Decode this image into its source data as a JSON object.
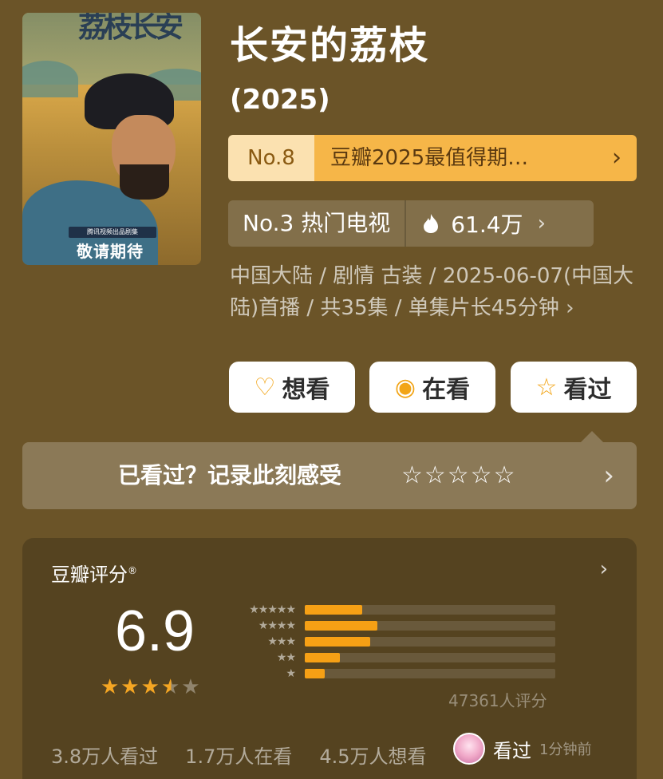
{
  "poster": {
    "title_art": "荔枝长安",
    "tag": "腾讯视频出品剧集",
    "banner": "敬请期待"
  },
  "title": "长安的荔枝",
  "year": "(2025)",
  "rank_primary": {
    "no": "No.8",
    "text": "豆瓣2025最值得期…",
    "chev": "›"
  },
  "rank_secondary": {
    "hot": "No.3 热门电视",
    "heat": "61.4万",
    "chev": "›"
  },
  "meta": "中国大陆 / 剧情 古装 / 2025-06-07(中国大陆)首播 / 共35集 / 单集片长45分钟 ›",
  "actions": {
    "want": {
      "icon": "♡",
      "label": "想看"
    },
    "watching": {
      "icon": "◉",
      "label": "在看"
    },
    "watched": {
      "icon": "☆",
      "label": "看过"
    }
  },
  "record": {
    "label": "已看过？记录此刻感受",
    "stars": "☆☆☆☆☆",
    "chev": "›"
  },
  "rating": {
    "label": "豆瓣评分",
    "reg": "®",
    "score": "6.9",
    "stars_value": 3.5,
    "stars_on": "★★★",
    "stars_half": "★",
    "stars_off": "★",
    "chev": "›",
    "distribution": [
      {
        "stars": "★★★★★",
        "fraction": 0.23
      },
      {
        "stars": "★★★★",
        "fraction": 0.29
      },
      {
        "stars": "★★★",
        "fraction": 0.26
      },
      {
        "stars": "★★",
        "fraction": 0.14
      },
      {
        "stars": "★",
        "fraction": 0.08
      }
    ],
    "count": "47361人评分"
  },
  "stats": [
    "3.8万人看过",
    "1.7万人在看",
    "4.5万人想看"
  ],
  "toast": {
    "action": "看过",
    "time": "1分钟前"
  },
  "colors": {
    "background": "#6b5428",
    "accent": "#f6b648",
    "star": "#f5a623"
  }
}
